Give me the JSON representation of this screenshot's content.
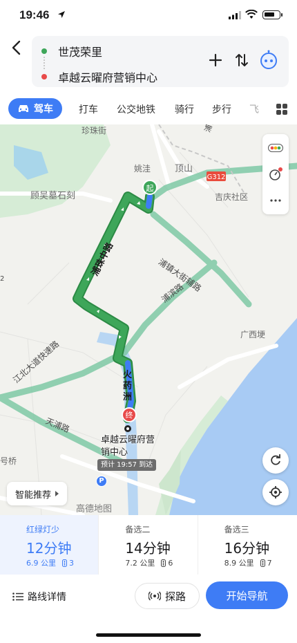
{
  "status": {
    "time": "19:46"
  },
  "route": {
    "from": "世茂荣里",
    "to": "卓越云曜府营销中心"
  },
  "modes": {
    "active": "驾车",
    "items": [
      "打车",
      "公交地铁",
      "骑行",
      "步行",
      "飞"
    ]
  },
  "map": {
    "place_labels": [
      "珍珠街",
      "顾吴墓石刻",
      "姚洼",
      "顶山",
      "吉庆社区",
      "广西埂",
      "号桥"
    ],
    "road_labels": [
      "浦珠中路",
      "浦镇大街辅路",
      "浦滨路",
      "江北大道快速路",
      "火药洲",
      "天浦路",
      "G312",
      "浦镇大街道",
      "2"
    ],
    "start_pin": "起",
    "end_pin": "终",
    "destination": "卓越云曜府营销中心",
    "eta": "预计 19:57 到达",
    "smart_recommend": "智能推荐",
    "logo": "高德地图",
    "parking": "P"
  },
  "options": [
    {
      "tag": "红绿灯少",
      "duration": "12分钟",
      "distance": "6.9 公里",
      "lights": "3"
    },
    {
      "tag": "备选二",
      "duration": "14分钟",
      "distance": "7.2 公里",
      "lights": "6"
    },
    {
      "tag": "备选三",
      "duration": "16分钟",
      "distance": "8.9 公里",
      "lights": "7"
    }
  ],
  "actions": {
    "details": "路线详情",
    "explore": "探路",
    "start": "开始导航"
  },
  "colors": {
    "accent": "#3e7cf5",
    "route": "#35a256",
    "start": "#3ea65a",
    "end": "#e84a4a"
  }
}
